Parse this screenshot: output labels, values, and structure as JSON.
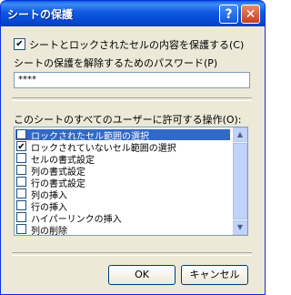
{
  "window": {
    "title": "シートの保護"
  },
  "title_buttons": {
    "help": "?",
    "close": "✕"
  },
  "protect_checkbox": {
    "checked": true,
    "label": "シートとロックされたセルの内容を保護する(C)"
  },
  "password": {
    "label": "シートの保護を解除するためのパスワード(P)",
    "value": "****"
  },
  "permissions": {
    "label": "このシートのすべてのユーザーに許可する操作(O):",
    "items": [
      {
        "label": "ロックされたセル範囲の選択",
        "checked": true,
        "selected": true
      },
      {
        "label": "ロックされていないセル範囲の選択",
        "checked": true,
        "selected": false
      },
      {
        "label": "セルの書式設定",
        "checked": false,
        "selected": false
      },
      {
        "label": "列の書式設定",
        "checked": false,
        "selected": false
      },
      {
        "label": "行の書式設定",
        "checked": false,
        "selected": false
      },
      {
        "label": "列の挿入",
        "checked": false,
        "selected": false
      },
      {
        "label": "行の挿入",
        "checked": false,
        "selected": false
      },
      {
        "label": "ハイパーリンクの挿入",
        "checked": false,
        "selected": false
      },
      {
        "label": "列の削除",
        "checked": false,
        "selected": false
      }
    ]
  },
  "buttons": {
    "ok": "OK",
    "cancel": "キャンセル"
  },
  "scroll_icons": {
    "up": "▲",
    "down": "▼"
  }
}
